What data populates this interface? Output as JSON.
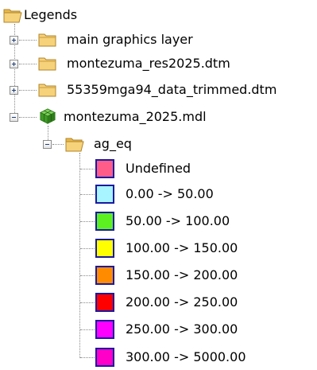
{
  "tree": {
    "root": {
      "label": "Legends",
      "icon": "folder-open-icon"
    },
    "layers": [
      {
        "label": "main graphics layer",
        "icon": "folder-icon",
        "expander": "plus"
      },
      {
        "label": "montezuma_res2025.dtm",
        "icon": "folder-icon",
        "expander": "plus"
      },
      {
        "label": "55359mga94_data_trimmed.dtm",
        "icon": "folder-icon",
        "expander": "plus"
      },
      {
        "label": "montezuma_2025.mdl",
        "icon": "green-cube-icon",
        "expander": "minus"
      }
    ],
    "attribute": {
      "label": "ag_eq",
      "icon": "folder-open-icon",
      "expander": "minus"
    },
    "legend_items": [
      {
        "label": "Undefined",
        "color": "#ff5c8a"
      },
      {
        "label": "0.00 -> 50.00",
        "color": "#a8f4ff"
      },
      {
        "label": "50.00 -> 100.00",
        "color": "#5cf020"
      },
      {
        "label": "100.00 -> 150.00",
        "color": "#ffff00"
      },
      {
        "label": "150.00 -> 200.00",
        "color": "#ff8c00"
      },
      {
        "label": "200.00 -> 250.00",
        "color": "#ff0000"
      },
      {
        "label": "250.00 -> 300.00",
        "color": "#ff00ff"
      },
      {
        "label": "300.00 -> 5000.00",
        "color": "#ff00c8"
      }
    ]
  }
}
